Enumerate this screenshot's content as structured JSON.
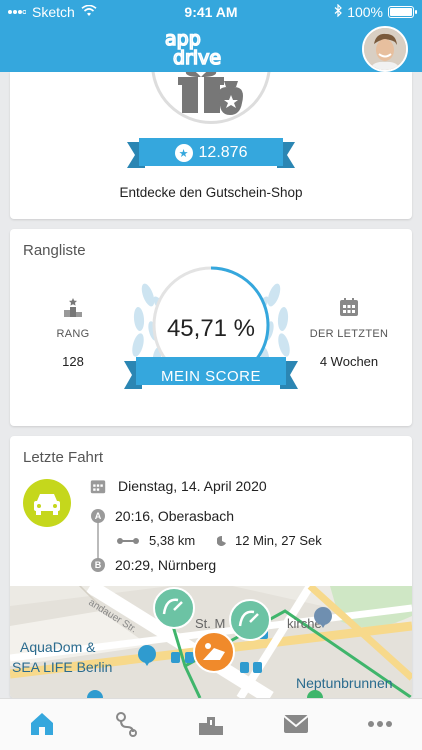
{
  "status_bar": {
    "carrier": "Sketch",
    "time": "9:41 AM",
    "battery": "100%"
  },
  "header": {
    "logo_top": "app",
    "logo_bottom": "drive"
  },
  "voucher_card": {
    "points": "12.876",
    "shop_link": "Entdecke den Gutschein-Shop"
  },
  "ranking_card": {
    "title": "Rangliste",
    "rank_label": "RANG",
    "rank_value": "128",
    "period_label": "DER LETZTEN",
    "period_value": "4 Wochen",
    "score_value": "45,71 %",
    "score_label": "MEIN SCORE",
    "score_fraction": 0.4571
  },
  "last_trip_card": {
    "title": "Letzte Fahrt",
    "date": "Dienstag, 14. April 2020",
    "start_letter": "A",
    "start": "20:16, Oberasbach",
    "distance": "5,38 km",
    "duration": "12 Min, 27 Sek",
    "end_letter": "B",
    "end": "20:29, Nürnberg"
  },
  "map": {
    "street_label": "andauer Str.",
    "church_label": "St. M",
    "church_label_2": "kirche",
    "poi_1": "AquaDom &",
    "poi_2": "SEA LIFE Berlin",
    "fountain": "Neptunbrunnen"
  },
  "colors": {
    "brand_blue": "#35a7dd",
    "car_green": "#c5d71c",
    "route_green": "#3fb56b",
    "marker_teal": "#6cc3a4",
    "marker_orange": "#f08a2b"
  },
  "tabs": [
    {
      "icon": "home-icon",
      "active": true
    },
    {
      "icon": "route-icon",
      "active": false
    },
    {
      "icon": "podium-icon",
      "active": false
    },
    {
      "icon": "mail-icon",
      "active": false
    },
    {
      "icon": "more-icon",
      "active": false
    }
  ]
}
